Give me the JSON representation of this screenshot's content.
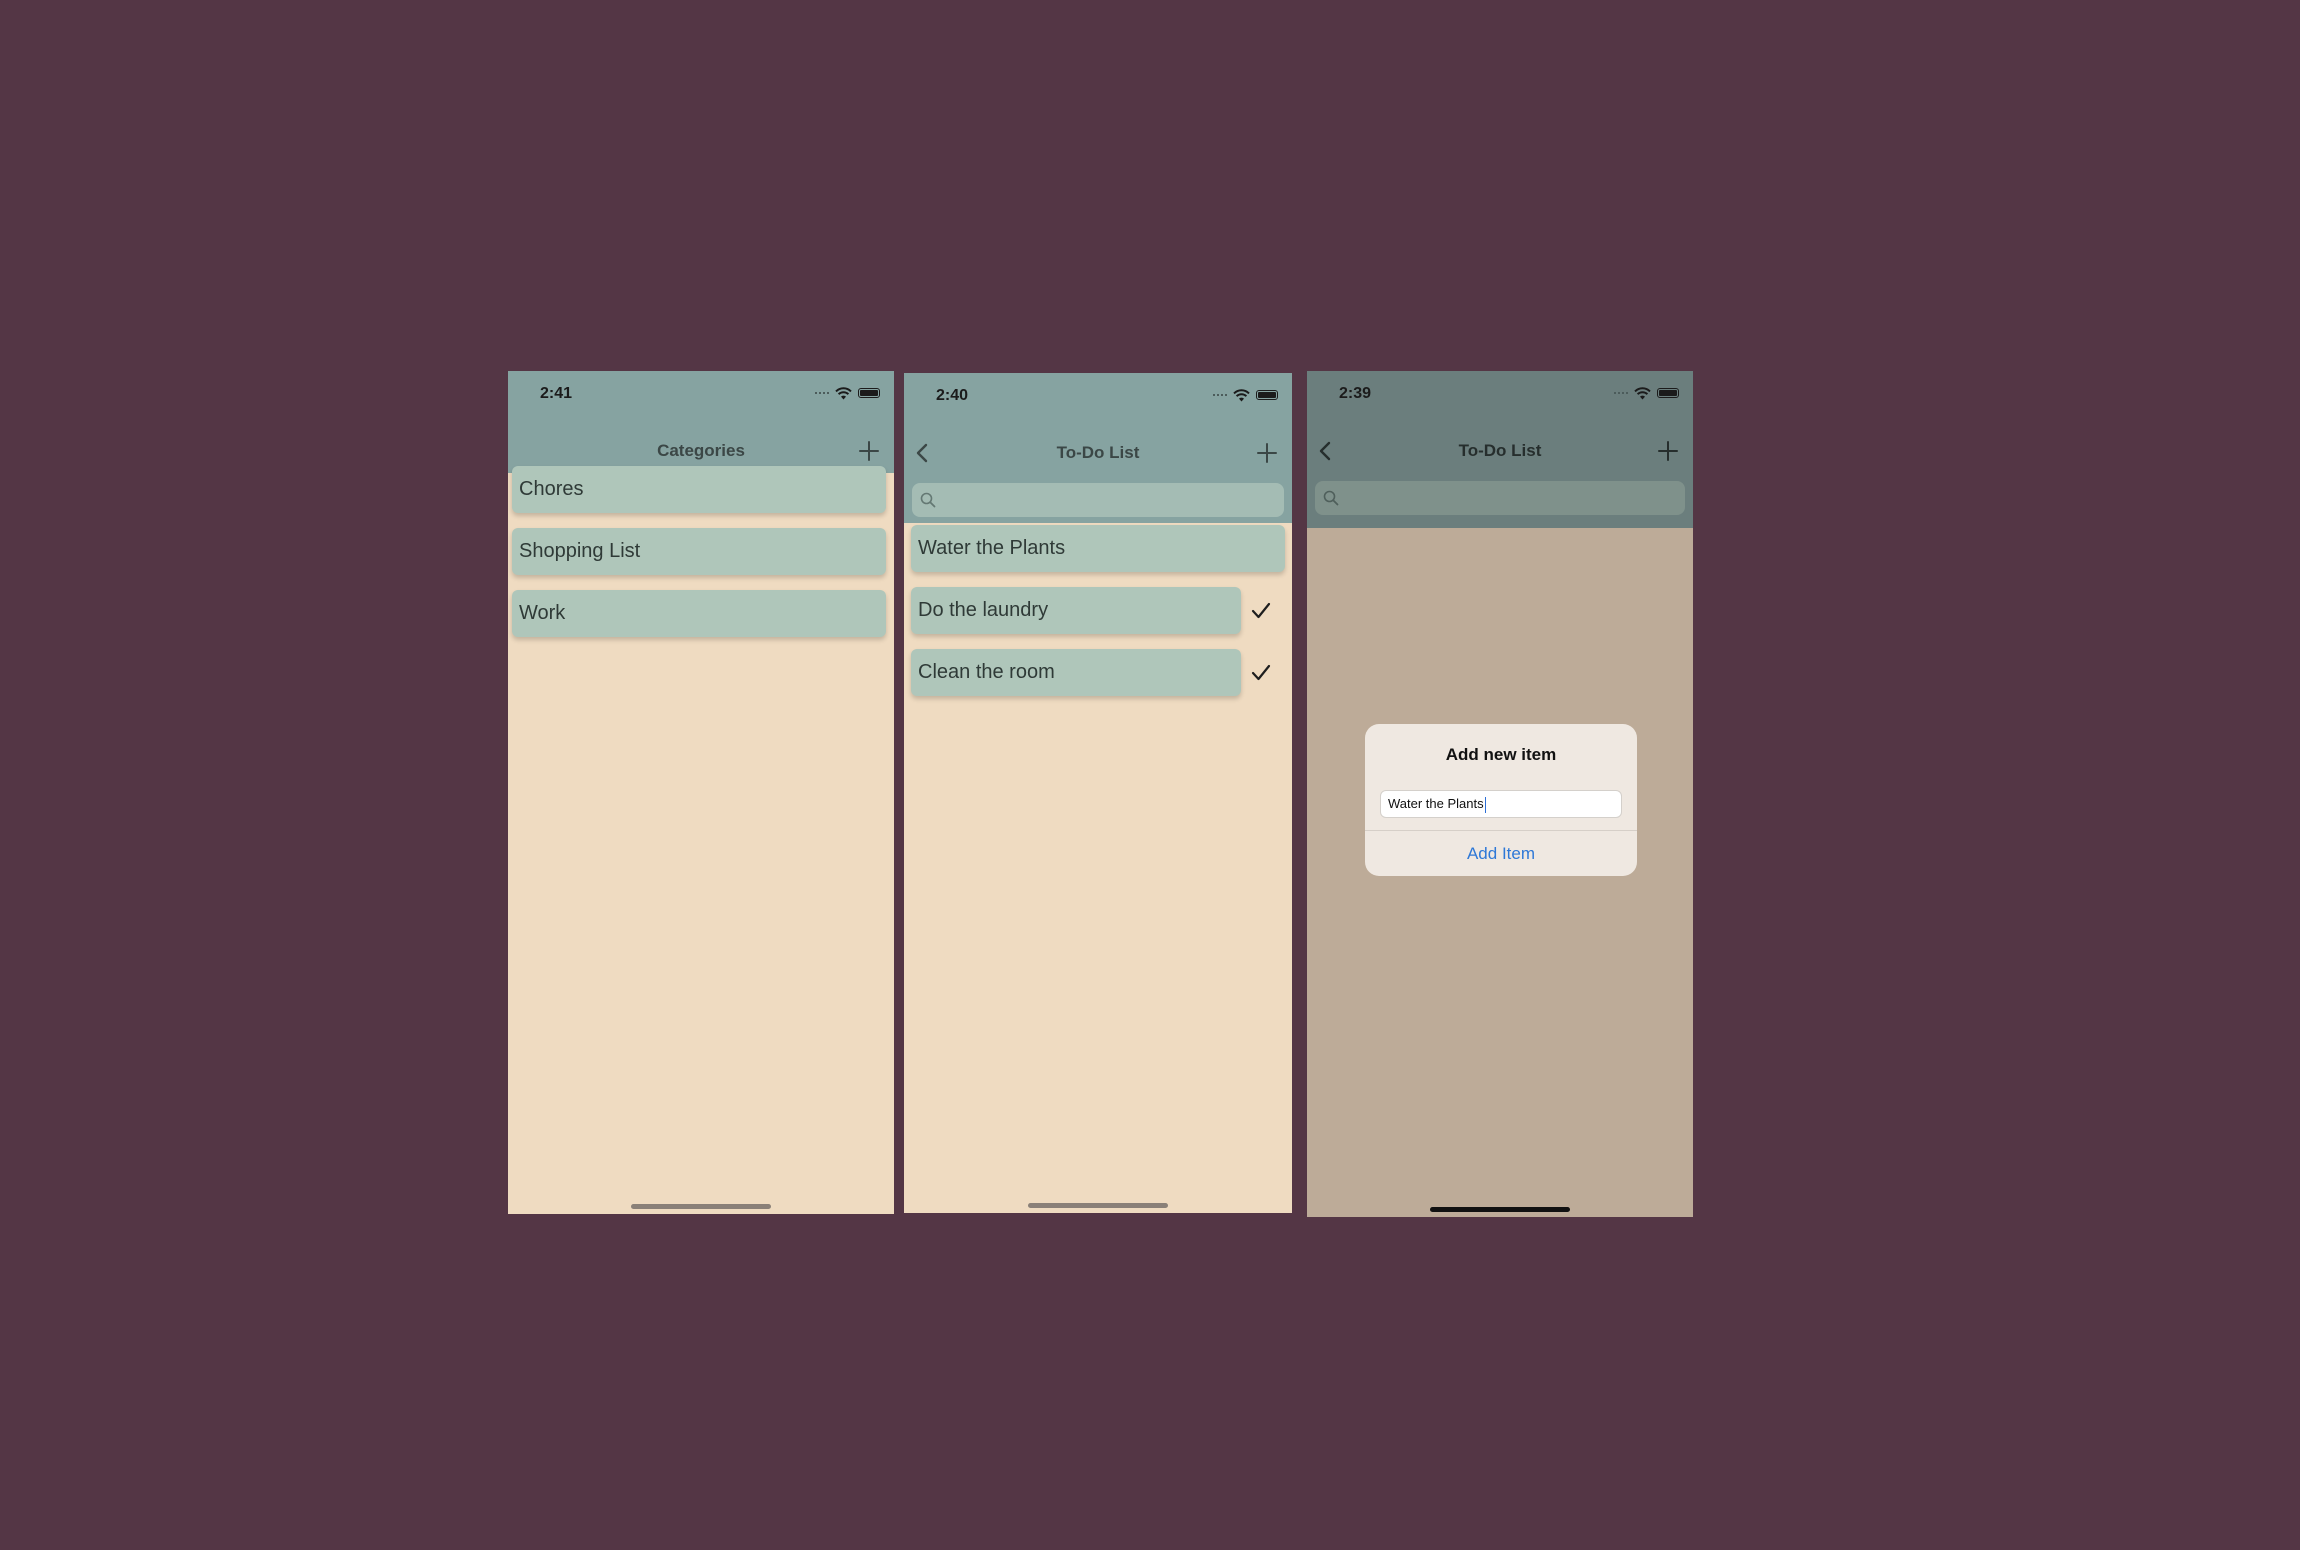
{
  "screens": [
    {
      "time": "2:41",
      "title": "Categories",
      "items": [
        "Chores",
        "Shopping List",
        "Work"
      ]
    },
    {
      "time": "2:40",
      "title": "To-Do List",
      "search_placeholder": "",
      "items": [
        {
          "label": "Water the Plants",
          "done": false
        },
        {
          "label": "Do the laundry",
          "done": true
        },
        {
          "label": "Clean the room",
          "done": true
        }
      ]
    },
    {
      "time": "2:39",
      "title": "To-Do List",
      "dialog": {
        "title": "Add new item",
        "input_value": "Water the Plants",
        "action_label": "Add Item"
      }
    }
  ],
  "icons": {
    "add": "plus-icon",
    "back": "chevron-left-icon",
    "search": "search-icon",
    "check": "checkmark-icon",
    "wifi": "wifi-icon",
    "battery": "battery-icon",
    "signal": "signal-icon"
  },
  "colors": {
    "background": "#543645",
    "nav_bar": "#86a3a1",
    "cell": "#afc6ba",
    "screen_background": "#efdbc1",
    "link": "#2e78d7"
  }
}
